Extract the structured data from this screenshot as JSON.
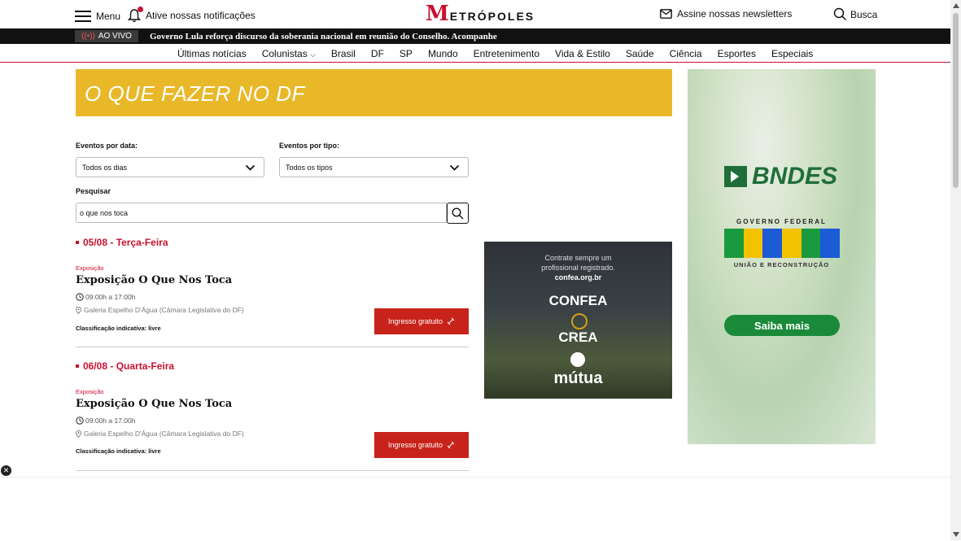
{
  "header": {
    "menu_label": "Menu",
    "notifications_label": "Ative nossas notificações",
    "logo_mark": "M",
    "logo_rest": "ETRÓPOLES",
    "newsletter_label": "Assine nossas newsletters",
    "search_label": "Busca"
  },
  "live": {
    "badge": "AO VIVO",
    "headline": "Governo Lula reforça discurso da soberania nacional em reunião do Conselho. Acompanhe"
  },
  "nav": {
    "items": [
      "Últimas notícias",
      "Colunistas",
      "Brasil",
      "DF",
      "SP",
      "Mundo",
      "Entretenimento",
      "Vida & Estilo",
      "Saúde",
      "Ciência",
      "Esportes",
      "Especiais"
    ]
  },
  "page": {
    "title": "O QUE FAZER NO DF"
  },
  "filters": {
    "date_label": "Eventos por data:",
    "date_value": "Todos os dias",
    "type_label": "Eventos por tipo:",
    "type_value": "Todos os tipos",
    "search_label": "Pesquisar",
    "search_value": "o que nos toca"
  },
  "events": [
    {
      "date": "05/08 - Terça-Feira",
      "category": "Exposição",
      "title": "Exposição O Que Nos Toca",
      "time": "09:00h a 17:00h",
      "place": "Galeria Espelho D'Água (Câmara Legislativa do DF)",
      "rating": "Classificação indicativa: livre",
      "button": "Ingresso gratuito"
    },
    {
      "date": "06/08 - Quarta-Feira",
      "category": "Exposição",
      "title": "Exposição O Que Nos Toca",
      "time": "09:00h a 17:00h",
      "place": "Galeria Espelho D'Água (Câmara Legislativa do DF)",
      "rating": "Classificação indicativa: livre",
      "button": "Ingresso gratuito"
    }
  ],
  "ad_confea": {
    "line1": "Contrate sempre um",
    "line2": "profissional registrado.",
    "url": "confea.org.br",
    "brand1": "CONFEA",
    "brand2": "CREA",
    "brand3": "mútua"
  },
  "ad_bndes": {
    "logo": "BNDES",
    "gov": "GOVERNO FEDERAL",
    "slogan": "UNIÃO E RECONSTRUÇÃO",
    "cta": "Saiba mais",
    "brasil_colors": [
      "#1a9a3e",
      "#f2c200",
      "#1c5bd6",
      "#f2c200",
      "#1a9a3e",
      "#1c5bd6"
    ]
  },
  "colors": {
    "accent": "#c8102e",
    "banner": "#e8b829",
    "button": "#c8231b"
  }
}
